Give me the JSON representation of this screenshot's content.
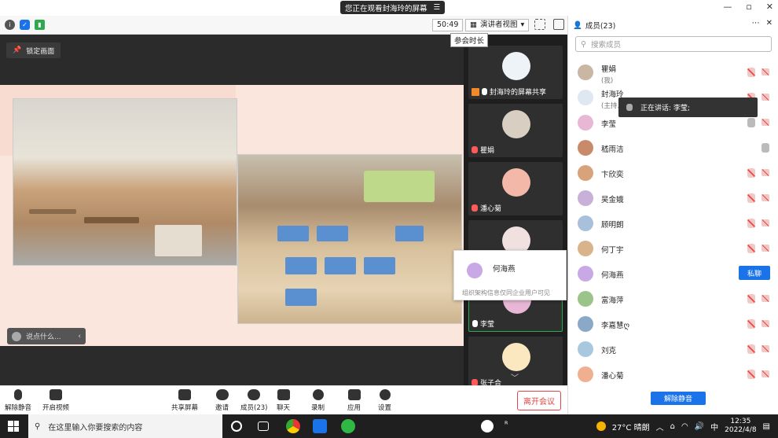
{
  "window": {
    "share_banner": "您正在观看封海玲的屏幕",
    "minimize": "—",
    "restore": "▫",
    "close": "✕"
  },
  "toolbar": {
    "timer": "50:49",
    "view_label": "演讲者视图",
    "tooltip": "参会时长",
    "lock_screen": "锁定画面"
  },
  "content": {
    "chat_placeholder": "说点什么..."
  },
  "thumbnails": [
    {
      "name": "封海玲的屏幕共享",
      "mic": "on"
    },
    {
      "name": "瞿娟",
      "mic": "off"
    },
    {
      "name": "潘心菊",
      "mic": "off"
    },
    {
      "name": "",
      "mic": "off"
    },
    {
      "name": "李莹",
      "mic": "on"
    },
    {
      "name": "张子合",
      "mic": "off"
    }
  ],
  "hover_card": {
    "name": "何海燕",
    "note": "组织架构信息仅同企业用户可见"
  },
  "bottom_toolbar": {
    "unmute": "解除静音",
    "video": "开启视频",
    "share": "共享屏幕",
    "invite": "邀请",
    "members": "成员(23)",
    "chat": "聊天",
    "record": "录制",
    "apps": "应用",
    "settings": "设置",
    "leave": "离开会议"
  },
  "panel": {
    "title": "成员(23)",
    "search_placeholder": "搜索成员",
    "speaking": "正在讲话: 李莹;",
    "unmute_all": "解除静音",
    "private_chat": "私聊",
    "participants": [
      {
        "name": "瞿娟",
        "sub": "(我)",
        "color": "#c9b7a4"
      },
      {
        "name": "封海玲",
        "sub": "(主持人)",
        "color": "#dfe8f2"
      },
      {
        "name": "李莹",
        "sub": "",
        "color": "#e8b7d6"
      },
      {
        "name": "嵇雨洁",
        "sub": "",
        "color": "#c98a6a"
      },
      {
        "name": "卞欣奕",
        "sub": "",
        "color": "#d8a27a"
      },
      {
        "name": "吴金娥",
        "sub": "",
        "color": "#c8b0d8"
      },
      {
        "name": "顾明朗",
        "sub": "",
        "color": "#a8c0dc"
      },
      {
        "name": "何丁宇",
        "sub": "",
        "color": "#d9b48a"
      },
      {
        "name": "何海燕",
        "sub": "",
        "color": "#c9a8e6"
      },
      {
        "name": "富海萍",
        "sub": "",
        "color": "#9ac48a"
      },
      {
        "name": "李嘉慧ღ",
        "sub": "",
        "color": "#8aa8c8"
      },
      {
        "name": "刘克",
        "sub": "",
        "color": "#a8c8e0"
      },
      {
        "name": "潘心菊",
        "sub": "",
        "color": "#f0b090"
      }
    ]
  },
  "taskbar": {
    "search_placeholder": "在这里输入你要搜索的内容",
    "weather": "27°C 晴朗",
    "ime": "中",
    "time": "12:35",
    "date": "2022/4/8"
  }
}
